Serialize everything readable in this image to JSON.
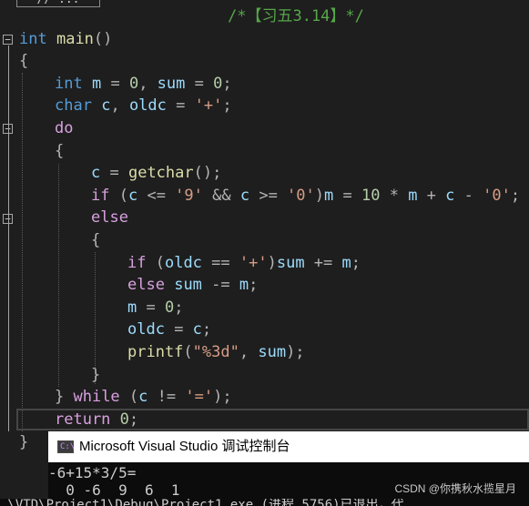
{
  "editor": {
    "top_snippet": "// ...",
    "lines": [
      {
        "tokens": [
          [
            "cmt",
            "/*【习五3.14】*/"
          ]
        ],
        "indent": 250
      },
      {
        "tokens": [
          [
            "kw",
            "int"
          ],
          [
            "txt",
            " "
          ],
          [
            "fn",
            "main"
          ],
          [
            "op",
            "()"
          ]
        ],
        "indent": 21
      },
      {
        "tokens": [
          [
            "op",
            "{"
          ]
        ],
        "indent": 21
      },
      {
        "tokens": [
          [
            "kw",
            "int"
          ],
          [
            "txt",
            " "
          ],
          [
            "id",
            "m"
          ],
          [
            "op",
            " = "
          ],
          [
            "num",
            "0"
          ],
          [
            "op",
            ", "
          ],
          [
            "id",
            "sum"
          ],
          [
            "op",
            " = "
          ],
          [
            "num",
            "0"
          ],
          [
            "op",
            ";"
          ]
        ],
        "indent": 60
      },
      {
        "tokens": [
          [
            "kw",
            "char"
          ],
          [
            "txt",
            " "
          ],
          [
            "id",
            "c"
          ],
          [
            "op",
            ", "
          ],
          [
            "id",
            "oldc"
          ],
          [
            "op",
            " = "
          ],
          [
            "str",
            "'+'"
          ],
          [
            "op",
            ";"
          ]
        ],
        "indent": 60
      },
      {
        "tokens": [
          [
            "ctl",
            "do"
          ]
        ],
        "indent": 60
      },
      {
        "tokens": [
          [
            "op",
            "{"
          ]
        ],
        "indent": 60
      },
      {
        "tokens": [
          [
            "id",
            "c"
          ],
          [
            "op",
            " = "
          ],
          [
            "fn",
            "getchar"
          ],
          [
            "op",
            "();"
          ]
        ],
        "indent": 100
      },
      {
        "tokens": [
          [
            "ctl",
            "if"
          ],
          [
            "op",
            " ("
          ],
          [
            "id",
            "c"
          ],
          [
            "op",
            " <= "
          ],
          [
            "str",
            "'9'"
          ],
          [
            "op",
            " && "
          ],
          [
            "id",
            "c"
          ],
          [
            "op",
            " >= "
          ],
          [
            "str",
            "'0'"
          ],
          [
            "op",
            ")"
          ],
          [
            "id",
            "m"
          ],
          [
            "op",
            " = "
          ],
          [
            "num",
            "10"
          ],
          [
            "op",
            " * "
          ],
          [
            "id",
            "m"
          ],
          [
            "op",
            " + "
          ],
          [
            "id",
            "c"
          ],
          [
            "op",
            " - "
          ],
          [
            "str",
            "'0'"
          ],
          [
            "op",
            ";"
          ]
        ],
        "indent": 100
      },
      {
        "tokens": [
          [
            "ctl",
            "else"
          ]
        ],
        "indent": 100
      },
      {
        "tokens": [
          [
            "op",
            "{"
          ]
        ],
        "indent": 100
      },
      {
        "tokens": [
          [
            "ctl",
            "if"
          ],
          [
            "op",
            " ("
          ],
          [
            "id",
            "oldc"
          ],
          [
            "op",
            " == "
          ],
          [
            "str",
            "'+'"
          ],
          [
            "op",
            ")"
          ],
          [
            "id",
            "sum"
          ],
          [
            "op",
            " += "
          ],
          [
            "id",
            "m"
          ],
          [
            "op",
            ";"
          ]
        ],
        "indent": 140
      },
      {
        "tokens": [
          [
            "ctl",
            "else"
          ],
          [
            "txt",
            " "
          ],
          [
            "id",
            "sum"
          ],
          [
            "op",
            " -= "
          ],
          [
            "id",
            "m"
          ],
          [
            "op",
            ";"
          ]
        ],
        "indent": 140
      },
      {
        "tokens": [
          [
            "id",
            "m"
          ],
          [
            "op",
            " = "
          ],
          [
            "num",
            "0"
          ],
          [
            "op",
            ";"
          ]
        ],
        "indent": 140
      },
      {
        "tokens": [
          [
            "id",
            "oldc"
          ],
          [
            "op",
            " = "
          ],
          [
            "id",
            "c"
          ],
          [
            "op",
            ";"
          ]
        ],
        "indent": 140
      },
      {
        "tokens": [
          [
            "fn",
            "printf"
          ],
          [
            "op",
            "("
          ],
          [
            "str",
            "\"%3d\""
          ],
          [
            "op",
            ", "
          ],
          [
            "id",
            "sum"
          ],
          [
            "op",
            ");"
          ]
        ],
        "indent": 140
      },
      {
        "tokens": [
          [
            "op",
            "}"
          ]
        ],
        "indent": 100
      },
      {
        "tokens": [
          [
            "op",
            "} "
          ],
          [
            "ctl",
            "while"
          ],
          [
            "op",
            " ("
          ],
          [
            "id",
            "c"
          ],
          [
            "op",
            " != "
          ],
          [
            "str",
            "'='"
          ],
          [
            "op",
            ");"
          ]
        ],
        "indent": 60
      },
      {
        "tokens": [
          [
            "ctl",
            "return"
          ],
          [
            "txt",
            " "
          ],
          [
            "num",
            "0"
          ],
          [
            "op",
            ";"
          ]
        ],
        "indent": 60
      },
      {
        "tokens": [
          [
            "op",
            "}"
          ]
        ],
        "indent": 21
      }
    ]
  },
  "console": {
    "title": "Microsoft Visual Studio 调试控制台",
    "icon_label": "C:\\",
    "input_line": "-6+15*3/5=",
    "output_line": "  0 -6  9  6  1",
    "cut_line": " \\VTD\\Project1\\Debug\\Project1.exe (进程 5756)已退出，代"
  },
  "watermark": "CSDN @你携秋水揽星月",
  "colors": {
    "background": "#1e1e1e",
    "keyword": "#569cd6",
    "control": "#d8a0df",
    "identifier": "#9cdcfe",
    "function": "#dcdcaa",
    "string": "#d69d85",
    "number": "#b5cea8",
    "comment": "#57a64a",
    "console_bg": "#0c0c0c"
  }
}
